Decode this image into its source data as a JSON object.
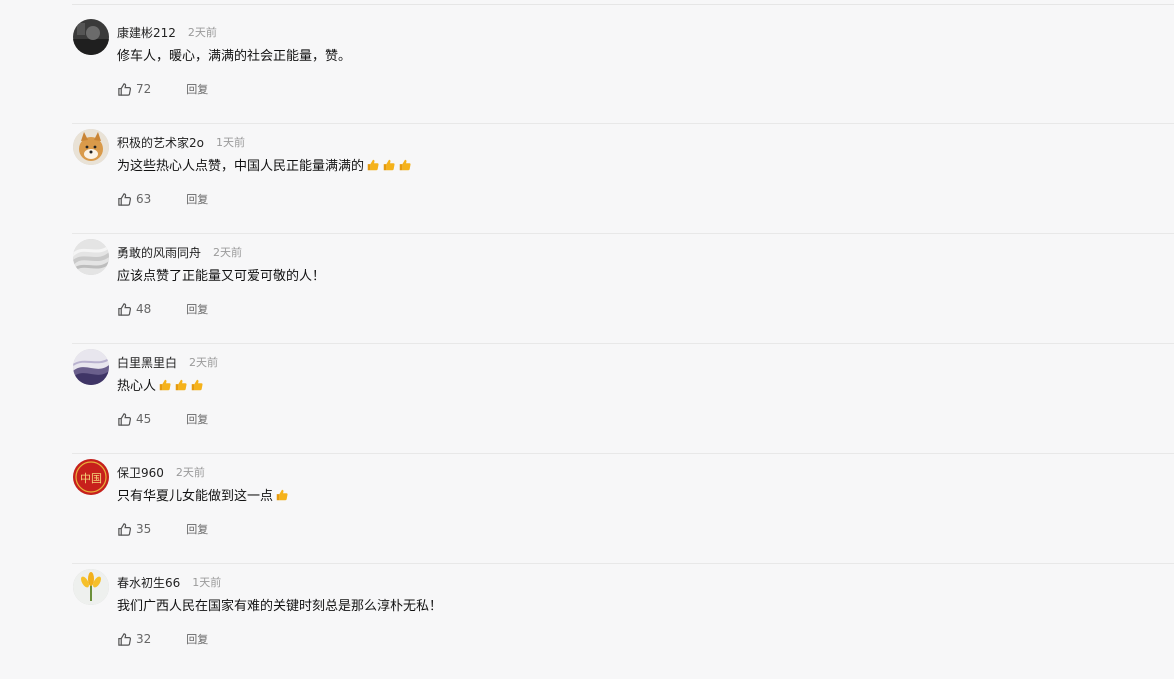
{
  "comments": [
    {
      "username": "康建彬212",
      "time": "2天前",
      "text": "修车人，暖心，满满的社会正能量，赞。",
      "likes": "72",
      "reply": "回复",
      "avatar": "dark-photo",
      "thumbs": 0
    },
    {
      "username": "积极的艺术家2o",
      "time": "1天前",
      "text": "为这些热心人点赞，中国人民正能量满满的",
      "likes": "63",
      "reply": "回复",
      "avatar": "shiba-dog",
      "thumbs": 3
    },
    {
      "username": "勇敢的风雨同舟",
      "time": "2天前",
      "text": "应该点赞了正能量又可爱可敬的人！",
      "likes": "48",
      "reply": "回复",
      "avatar": "grey-swirl",
      "thumbs": 0
    },
    {
      "username": "白里黑里白",
      "time": "2天前",
      "text": "热心人",
      "likes": "45",
      "reply": "回复",
      "avatar": "purple-wave",
      "thumbs": 3
    },
    {
      "username": "保卫960",
      "time": "2天前",
      "text": "只有华夏儿女能做到这一点",
      "likes": "35",
      "reply": "回复",
      "avatar": "red-china-badge",
      "thumbs": 1
    },
    {
      "username": "春水初生66",
      "time": "1天前",
      "text": "我们广西人民在国家有难的关键时刻总是那么淳朴无私！",
      "likes": "32",
      "reply": "回复",
      "avatar": "yellow-flower",
      "thumbs": 0
    }
  ],
  "avatar_badge_text": "中国",
  "colors": {
    "background": "#f7f7f8",
    "username": "#222222",
    "time": "#9a9a9a",
    "thumbs_emoji": "#f5b21b"
  }
}
